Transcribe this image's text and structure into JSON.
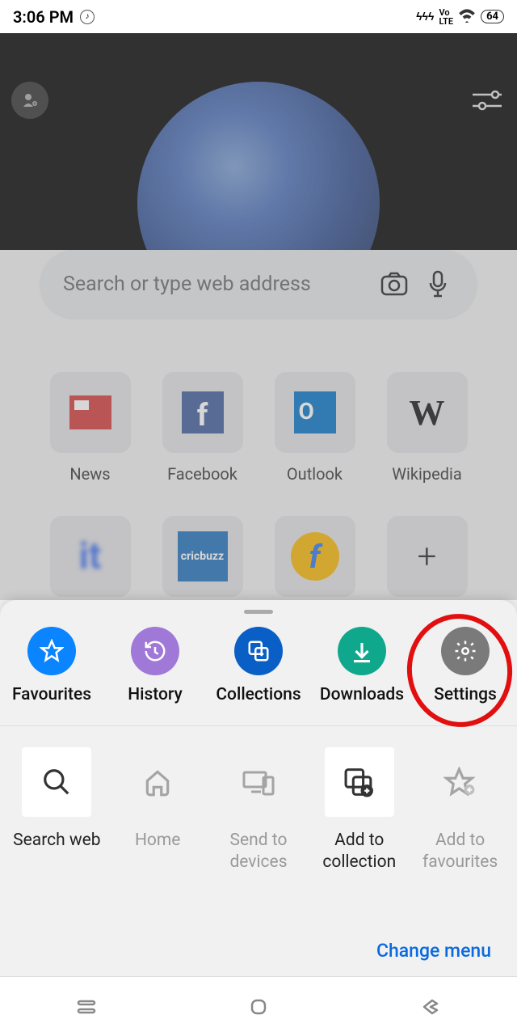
{
  "status": {
    "time": "3:06 PM",
    "battery": "64",
    "volte": "VoLTE",
    "charge": "⚡"
  },
  "search": {
    "placeholder": "Search or type web address"
  },
  "speed_dial": [
    {
      "label": "News"
    },
    {
      "label": "Facebook"
    },
    {
      "label": "Outlook"
    },
    {
      "label": "Wikipedia"
    },
    {
      "label": ""
    },
    {
      "label": ""
    },
    {
      "label": ""
    },
    {
      "label": ""
    }
  ],
  "quick": [
    {
      "label": "Favourites"
    },
    {
      "label": "History"
    },
    {
      "label": "Collections"
    },
    {
      "label": "Downloads"
    },
    {
      "label": "Settings"
    }
  ],
  "actions": [
    {
      "label": "Search web"
    },
    {
      "label": "Home"
    },
    {
      "label": "Send to devices"
    },
    {
      "label": "Add to collection"
    },
    {
      "label": "Add to favourites"
    }
  ],
  "footer": {
    "change_menu": "Change menu"
  },
  "cricbuzz": "cricbuzz"
}
